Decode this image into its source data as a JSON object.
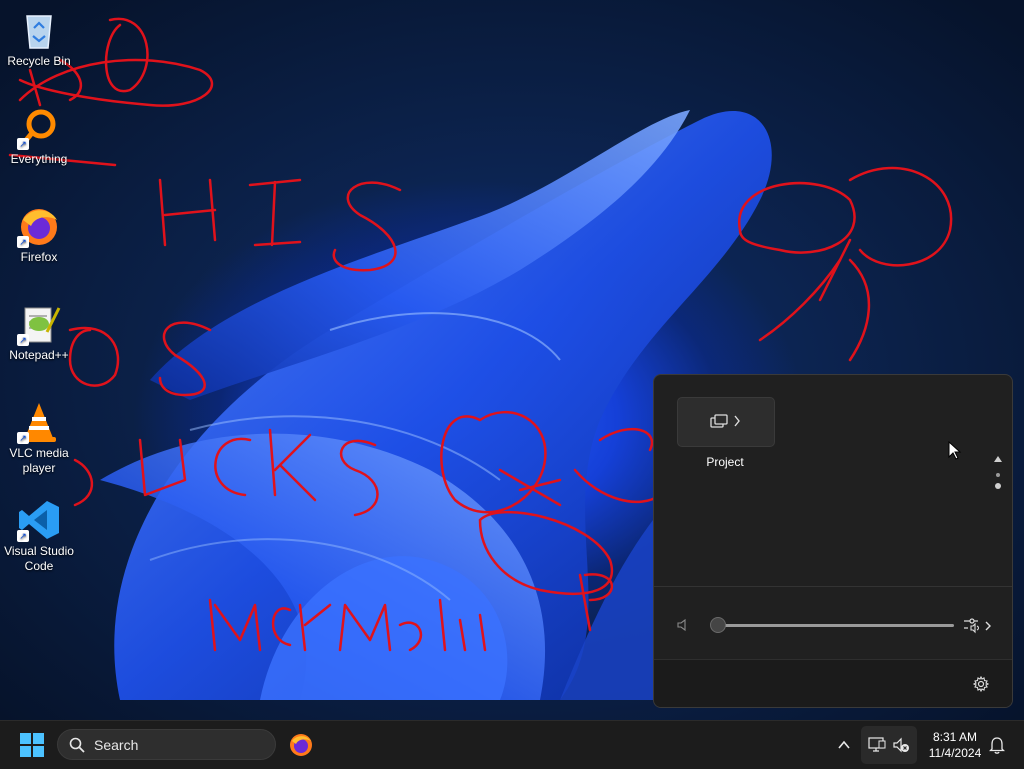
{
  "desktop": {
    "icons": [
      {
        "label": "Recycle Bin",
        "icon": "recycle-bin-icon"
      },
      {
        "label": "Everything",
        "icon": "everything-search-icon"
      },
      {
        "label": "Firefox",
        "icon": "firefox-icon"
      },
      {
        "label": "Notepad++",
        "icon": "notepad-plus-plus-icon"
      },
      {
        "label": "VLC media player",
        "icon": "vlc-icon"
      },
      {
        "label": "Visual Studio Code",
        "icon": "vscode-icon"
      }
    ]
  },
  "quick_settings": {
    "project_tile_label": "Project",
    "volume_level": 0,
    "volume_state": "muted"
  },
  "taskbar": {
    "search_placeholder": "Search",
    "clock_time": "8:31 AM",
    "clock_date": "11/4/2024"
  },
  "colors": {
    "ink": "#e0121b",
    "accent": "#2f6bff",
    "taskbar": "#1c1c1c",
    "panel": "#202020"
  }
}
